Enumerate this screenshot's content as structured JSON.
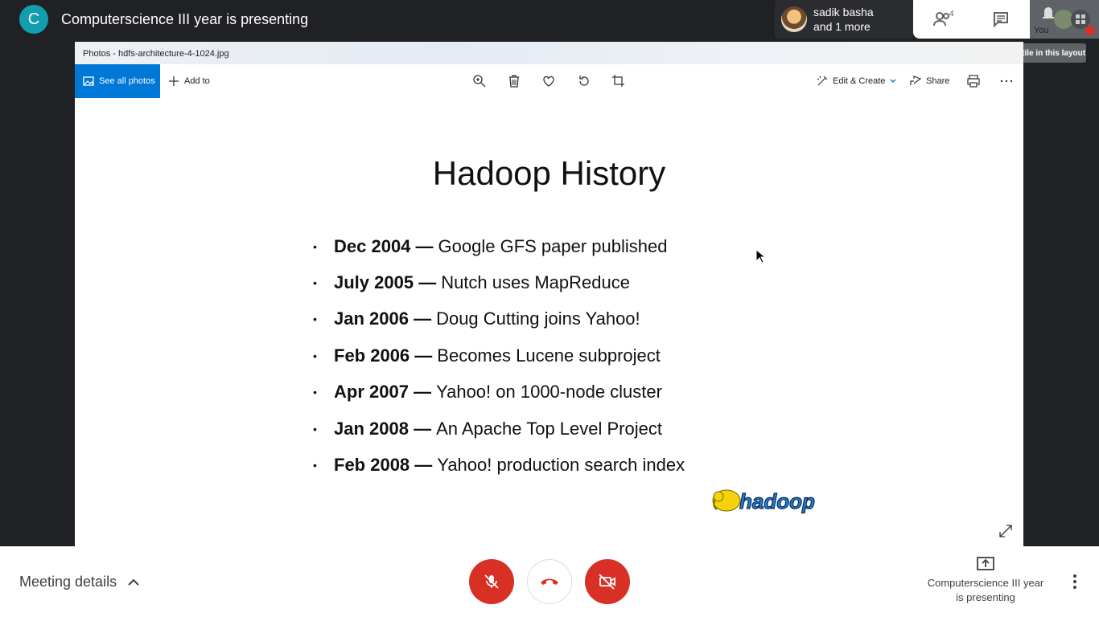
{
  "meet": {
    "avatar_letter": "C",
    "title": "Computerscience III year is presenting",
    "presenter_name_line1": "sadik basha",
    "presenter_name_line2": "and 1 more",
    "people_count": "4",
    "you_label": "You",
    "tooltip": "Can't show you in a tile in this layout"
  },
  "photos": {
    "window_title": "Photos - hdfs-architecture-4-1024.jpg",
    "see_all_label": "See all photos",
    "add_to_label": "Add to",
    "edit_create_label": "Edit & Create",
    "share_label": "Share",
    "accent": "#0078d7"
  },
  "slide": {
    "title": "Hadoop History",
    "items": [
      {
        "date": "Dec 2004 —",
        "text": "Google GFS paper published"
      },
      {
        "date": "July 2005 —",
        "text": "Nutch uses MapReduce"
      },
      {
        "date": "Jan 2006 —",
        "text": "Doug Cutting joins Yahoo!"
      },
      {
        "date": "Feb 2006 —",
        "text": "Becomes Lucene subproject"
      },
      {
        "date": "Apr 2007 —",
        "text": "Yahoo! on 1000-node cluster"
      },
      {
        "date": "Jan 2008 —",
        "text": "An Apache Top Level Project"
      },
      {
        "date": "Feb 2008 —",
        "text": "Yahoo! production search index"
      }
    ],
    "logo_text": "hadoop"
  },
  "bottom": {
    "meeting_details_label": "Meeting details",
    "present_line1": "Computerscience III year",
    "present_line2": "is presenting",
    "danger_color": "#d93025"
  }
}
